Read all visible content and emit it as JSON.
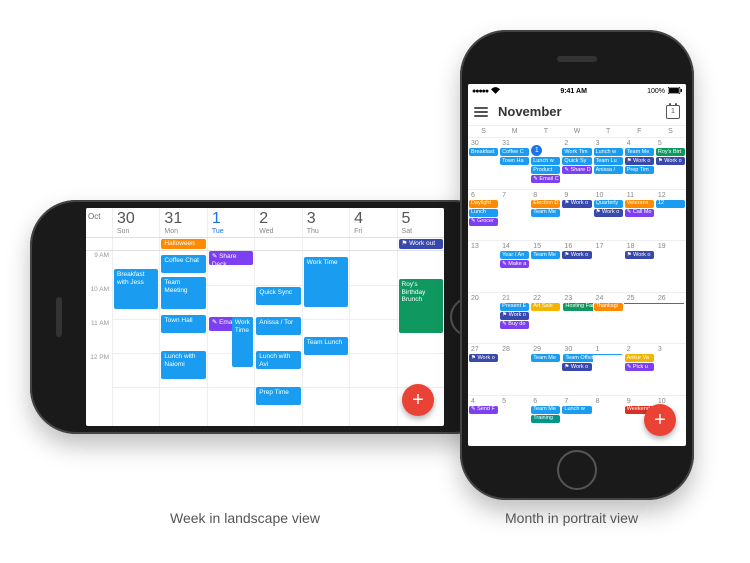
{
  "captions": {
    "landscape": "Week in landscape view",
    "portrait": "Month in portrait view"
  },
  "colors": {
    "blue": "#1a9df0",
    "orange": "#ff8a00",
    "purple": "#7e3ff2",
    "green": "#0f9960",
    "dkblue": "#3949ab",
    "yellow": "#f5b400",
    "red": "#ea4335"
  },
  "week": {
    "month_label": "Oct",
    "time_labels": [
      "9 AM",
      "10 AM",
      "11 AM",
      "12 PM"
    ],
    "days": [
      {
        "num": "30",
        "name": "Sun",
        "today": false
      },
      {
        "num": "31",
        "name": "Mon",
        "today": false
      },
      {
        "num": "1",
        "name": "Tue",
        "today": true
      },
      {
        "num": "2",
        "name": "Wed",
        "today": false
      },
      {
        "num": "3",
        "name": "Thu",
        "today": false
      },
      {
        "num": "4",
        "name": "Fri",
        "today": false
      },
      {
        "num": "5",
        "name": "Sat",
        "today": false
      }
    ],
    "allday": {
      "mon": "Halloween",
      "sat": "⚑ Work out"
    },
    "events": {
      "sun_breakfast": "Breakfast with Jess",
      "mon_coffee": "Coffee Chat",
      "mon_meeting": "Team Meeting",
      "mon_townhall": "Town Hall",
      "mon_lunch": "Lunch with Naiomi",
      "tue_share": "✎ Share Deck",
      "tue_email": "✎ Email Salit",
      "tue_work": "Work Time",
      "wed_sync": "Quick Sync",
      "wed_anissa": "Anissa / Tor",
      "wed_lunch": "Lunch with Avi",
      "wed_prep": "Prep Time",
      "thu_work": "Work Time",
      "thu_lunch": "Team Lunch",
      "sat_roy": "Roy's Birthday Brunch"
    }
  },
  "portrait": {
    "status": {
      "carrier_dots": "●●●●●",
      "wifi": "✓",
      "time": "9:41 AM",
      "battery_pct": "100%"
    },
    "title": "November",
    "today_num": "1",
    "dow": [
      "S",
      "M",
      "T",
      "W",
      "T",
      "F",
      "S"
    ],
    "weeks": [
      {
        "dates": [
          "30",
          "31",
          "1",
          "2",
          "3",
          "4",
          "5"
        ],
        "today_index": 2,
        "cells": [
          [
            {
              "t": "Breakfast",
              "c": "blue"
            }
          ],
          [
            {
              "t": "Coffee C",
              "c": "blue"
            },
            {
              "t": "Town Ha",
              "c": "blue"
            }
          ],
          [
            {
              "t": "Lunch w",
              "c": "blue"
            },
            {
              "t": "Product",
              "c": "blue"
            },
            {
              "t": "✎ Email C",
              "c": "purple"
            }
          ],
          [
            {
              "t": "Work Tim",
              "c": "blue"
            },
            {
              "t": "Quick Sy",
              "c": "blue"
            },
            {
              "t": "✎ Share D",
              "c": "purple"
            }
          ],
          [
            {
              "t": "Lunch w",
              "c": "blue"
            },
            {
              "t": "Team Lu",
              "c": "blue"
            },
            {
              "t": "Anissa /",
              "c": "blue"
            }
          ],
          [
            {
              "t": "Team Me",
              "c": "blue"
            },
            {
              "t": "⚑ Work o",
              "c": "dkblue"
            },
            {
              "t": "Prep Tim",
              "c": "blue"
            }
          ],
          [
            {
              "t": "Roy's Birt",
              "c": "green"
            },
            {
              "t": "⚑ Work o",
              "c": "dkblue"
            }
          ]
        ]
      },
      {
        "dates": [
          "6",
          "7",
          "8",
          "9",
          "10",
          "11",
          "12"
        ],
        "cells": [
          [
            {
              "t": "Daylight",
              "c": "orange"
            },
            {
              "t": "Lunch",
              "c": "blue"
            },
            {
              "t": "✎ Grocer",
              "c": "purple"
            }
          ],
          [],
          [
            {
              "t": "Election D",
              "c": "orange"
            },
            {
              "t": "Team Me",
              "c": "blue"
            }
          ],
          [
            {
              "t": "⚑ Work o",
              "c": "dkblue"
            }
          ],
          [
            {
              "t": "Quarterly",
              "c": "blue"
            },
            {
              "t": "⚑ Work o",
              "c": "dkblue"
            }
          ],
          [
            {
              "t": "Veterans",
              "c": "orange"
            },
            {
              "t": "✎ Call Mo",
              "c": "purple"
            }
          ],
          [
            {
              "t": "12",
              "c": "blue"
            }
          ]
        ]
      },
      {
        "dates": [
          "13",
          "14",
          "15",
          "16",
          "17",
          "18",
          "19"
        ],
        "cells": [
          [],
          [
            {
              "t": "Year / An",
              "c": "blue"
            },
            {
              "t": "✎ Make a",
              "c": "purple"
            }
          ],
          [
            {
              "t": "Team Me",
              "c": "blue"
            }
          ],
          [
            {
              "t": "⚑ Work o",
              "c": "dkblue"
            }
          ],
          [],
          [
            {
              "t": "⚑ Work o",
              "c": "dkblue"
            }
          ],
          []
        ]
      },
      {
        "dates": [
          "20",
          "21",
          "22",
          "23",
          "24",
          "25",
          "26"
        ],
        "cells": [
          [],
          [
            {
              "t": "Present E",
              "c": "blue"
            },
            {
              "t": "⚑ Work o",
              "c": "dkblue"
            },
            {
              "t": "✎ Buy do",
              "c": "purple"
            }
          ],
          [
            {
              "t": "Art Sale",
              "c": "yellow"
            }
          ],
          [
            {
              "t": "Hosting Family for Thanksgiving",
              "c": "green",
              "span": "start"
            }
          ],
          [
            {
              "t": "Thanksgi",
              "c": "orange"
            }
          ],
          [
            {
              "t": " ",
              "c": "green",
              "span": "mid"
            }
          ],
          [
            {
              "t": " ",
              "c": "green",
              "span": "end"
            }
          ]
        ]
      },
      {
        "dates": [
          "27",
          "28",
          "29",
          "30",
          "1",
          "2",
          "3"
        ],
        "cells": [
          [
            {
              "t": "⚑ Work o",
              "c": "dkblue"
            }
          ],
          [],
          [
            {
              "t": "Team Me",
              "c": "blue"
            }
          ],
          [
            {
              "t": "Team Offsite",
              "c": "blue",
              "span": "start"
            },
            {
              "t": "⚑ Work o",
              "c": "dkblue"
            }
          ],
          [
            {
              "t": " ",
              "c": "blue",
              "span": "end"
            }
          ],
          [
            {
              "t": "Ankur Va",
              "c": "yellow"
            },
            {
              "t": "✎ Pick u",
              "c": "purple"
            }
          ],
          []
        ]
      },
      {
        "dates": [
          "4",
          "5",
          "6",
          "7",
          "8",
          "9",
          "10"
        ],
        "cells": [
          [
            {
              "t": "✎ Send F",
              "c": "purple"
            }
          ],
          [],
          [
            {
              "t": "Team Me",
              "c": "blue"
            },
            {
              "t": "Training",
              "c": "teal"
            }
          ],
          [
            {
              "t": "Lunch w",
              "c": "blue"
            }
          ],
          [],
          [
            {
              "t": "Weekend in Portland",
              "c": "red"
            }
          ],
          []
        ]
      }
    ]
  }
}
